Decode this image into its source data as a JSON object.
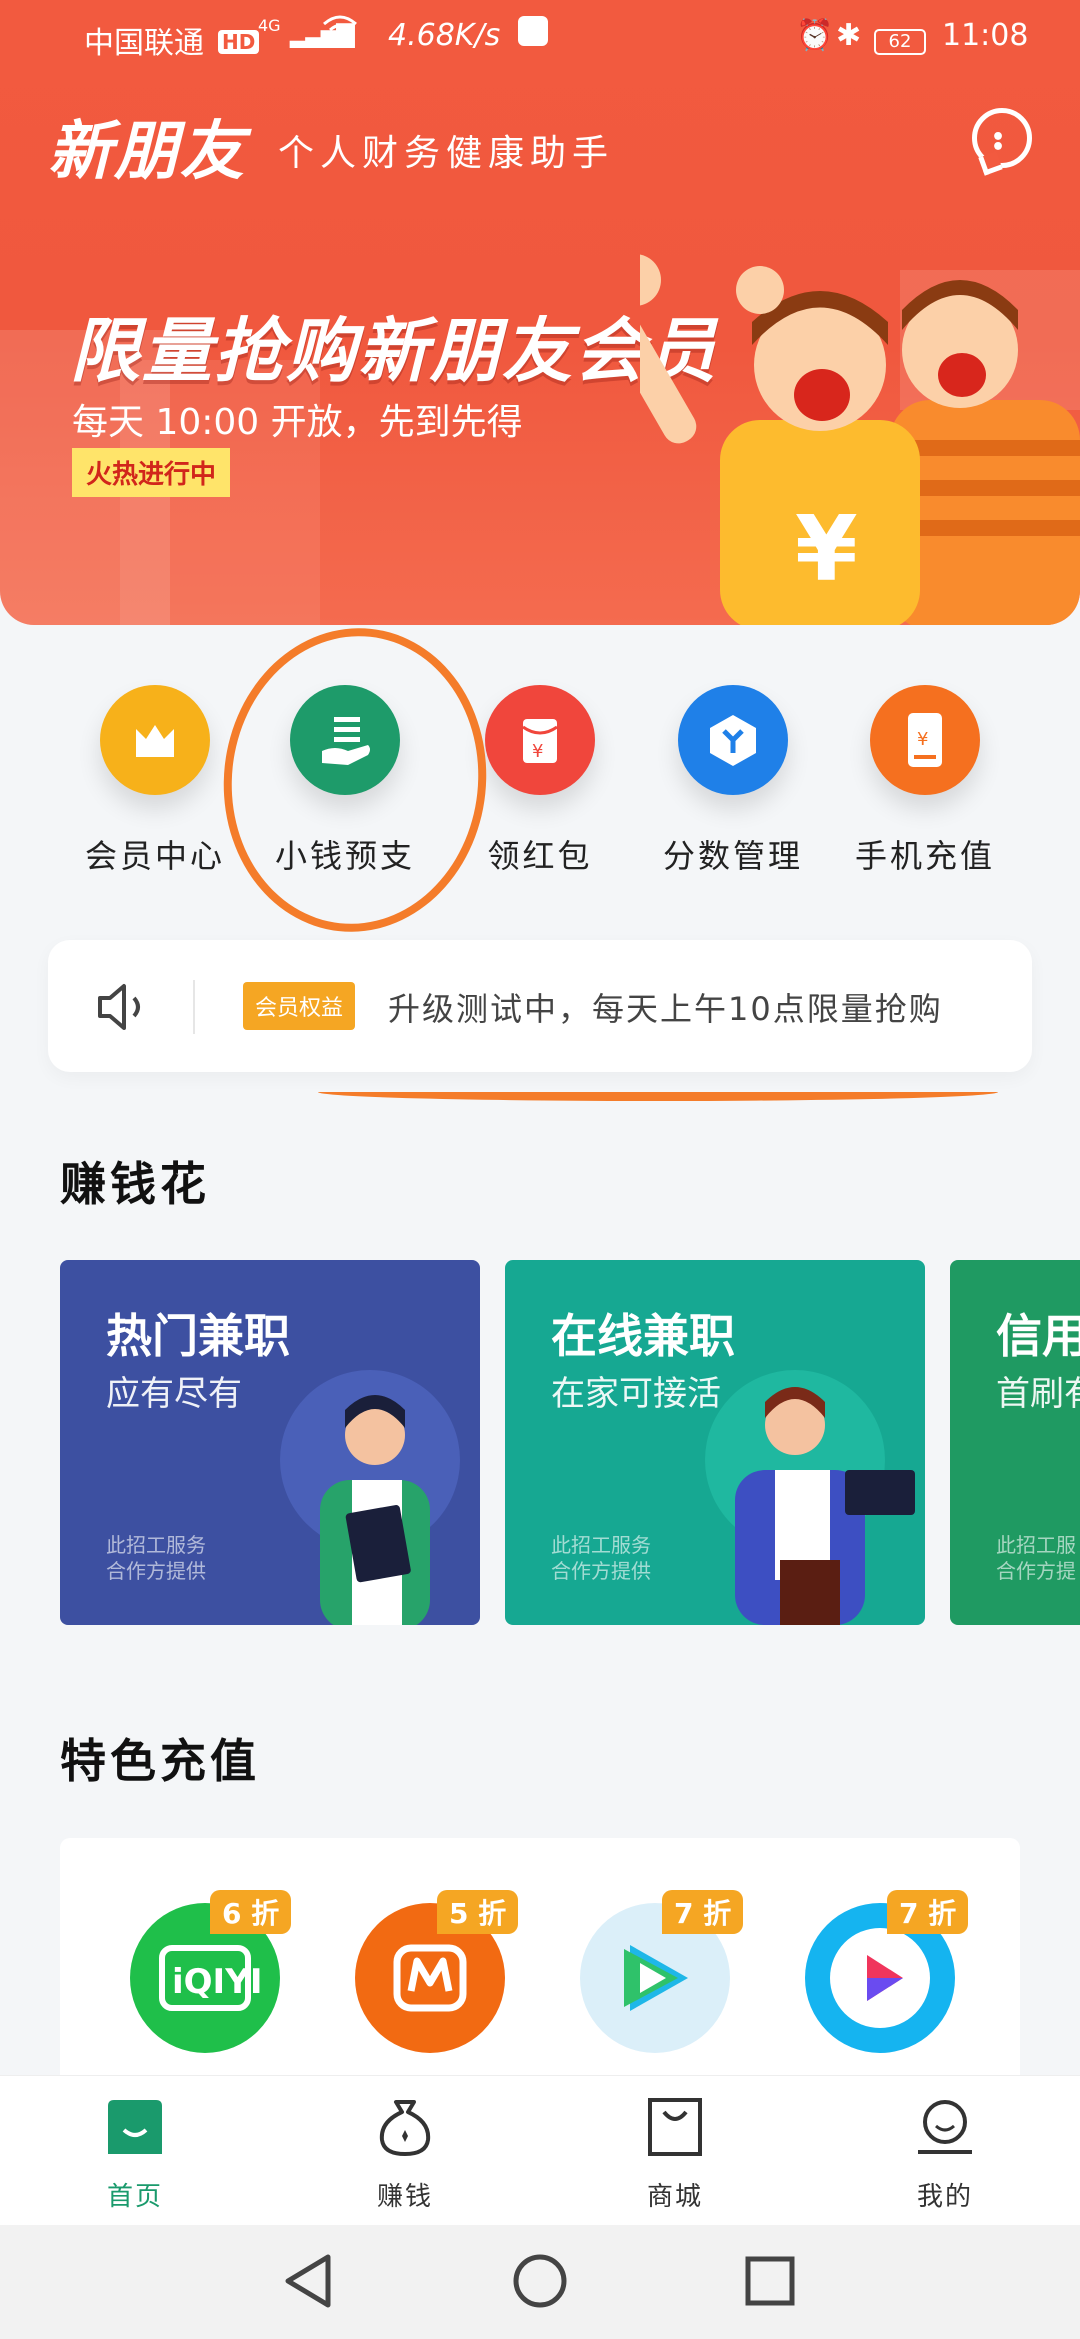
{
  "status_bar": {
    "carrier": "中国联通",
    "hd": "HD",
    "network": "4G",
    "speed": "4.68K/s",
    "battery": "62",
    "time": "11:08"
  },
  "header": {
    "brand": "新朋友",
    "slogan": "个人财务健康助手",
    "message_icon": "chat-bubble-icon"
  },
  "banner": {
    "title": "限量抢购新朋友会员",
    "subtitle": "每天 10:00 开放，先到先得",
    "tag": "火热进行中"
  },
  "quick_menu": [
    {
      "label": "会员中心",
      "icon": "crown-icon",
      "color": "#f7b11a"
    },
    {
      "label": "小钱预支",
      "icon": "hand-coin-icon",
      "color": "#1e9b6a"
    },
    {
      "label": "领红包",
      "icon": "red-envelope-icon",
      "color": "#f0463c"
    },
    {
      "label": "分数管理",
      "icon": "cube-icon",
      "color": "#1f80e8"
    },
    {
      "label": "手机充值",
      "icon": "phone-yuan-icon",
      "color": "#f5701f"
    }
  ],
  "notice": {
    "tag": "会员权益",
    "text": "升级测试中，每天上午10点限量抢购"
  },
  "earn": {
    "title": "赚钱花",
    "cards": [
      {
        "title": "热门兼职",
        "subtitle": "应有尽有",
        "note1": "此招工服务",
        "note2": "合作方提供",
        "color": "#3d50a1"
      },
      {
        "title": "在线兼职",
        "subtitle": "在家可接活",
        "note1": "此招工服务",
        "note2": "合作方提供",
        "color": "#16a892"
      },
      {
        "title": "信用",
        "subtitle": "首刷有",
        "note1": "此招工服",
        "note2": "合作方提",
        "color": "#1f9a62"
      }
    ]
  },
  "recharge": {
    "title": "特色充值",
    "items": [
      {
        "name": "iQIYI",
        "badge": "6 折",
        "color": "#1fbf4a"
      },
      {
        "name": "mango-tv",
        "badge": "5 折",
        "color": "#f26a12"
      },
      {
        "name": "tencent-video",
        "badge": "7 折",
        "color": "#dbeff9"
      },
      {
        "name": "youku",
        "badge": "7 折",
        "color": "#15b4f0"
      }
    ]
  },
  "tabbar": [
    {
      "label": "首页",
      "icon": "home-icon",
      "active": true
    },
    {
      "label": "赚钱",
      "icon": "money-bag-icon",
      "active": false
    },
    {
      "label": "商城",
      "icon": "shopping-bag-icon",
      "active": false
    },
    {
      "label": "我的",
      "icon": "user-icon",
      "active": false
    }
  ]
}
